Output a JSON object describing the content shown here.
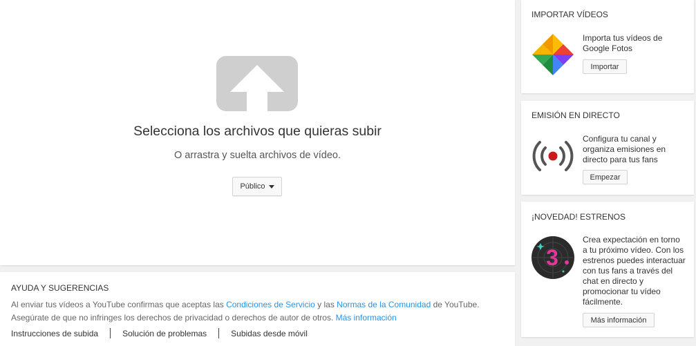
{
  "upload": {
    "title": "Selecciona los archivos que quieras subir",
    "subtitle": "O arrastra y suelta archivos de vídeo.",
    "privacy_label": "Público",
    "upload_icon": "upload-arrow-icon",
    "icon_color": "#cfcfcf"
  },
  "help": {
    "title": "AYUDA Y SUGERENCIAS",
    "line1_prefix": "Al enviar tus vídeos a YouTube confirmas que aceptas las ",
    "terms_link": "Condiciones de Servicio",
    "line1_middle": " y las ",
    "community_link": "Normas de la Comunidad",
    "line1_suffix": " de YouTube.",
    "line2_text": "Asegúrate de que no infringes los derechos de privacidad o derechos de autor de otros. ",
    "more_info_link": "Más información",
    "links": [
      "Instrucciones de subida",
      "Solución de problemas",
      "Subidas desde móvil"
    ]
  },
  "sidebar": {
    "import": {
      "title": "IMPORTAR VÍDEOS",
      "text": "Importa tus vídeos de Google Fotos",
      "button": "Importar",
      "icon": "google-photos-pinwheel-icon"
    },
    "live": {
      "title": "EMISIÓN EN DIRECTO",
      "text": "Configura tu canal y organiza emisiones en directo para tus fans",
      "button": "Empezar",
      "icon": "live-broadcast-icon"
    },
    "premiere": {
      "title": "¡NOVEDAD! ESTRENOS",
      "text": "Crea expectación en torno a tu próximo vídeo. Con los estrenos puedes interactuar con tus fans a través del chat en directo y promocionar tu vídeo fácilmente.",
      "button": "Más información",
      "icon": "premiere-countdown-icon",
      "countdown": "3"
    }
  },
  "colors": {
    "link": "#2793e6",
    "live_dot": "#cc1a1a",
    "premiere_accent": "#e0389a",
    "premiere_bg": "#2b2b2b"
  }
}
